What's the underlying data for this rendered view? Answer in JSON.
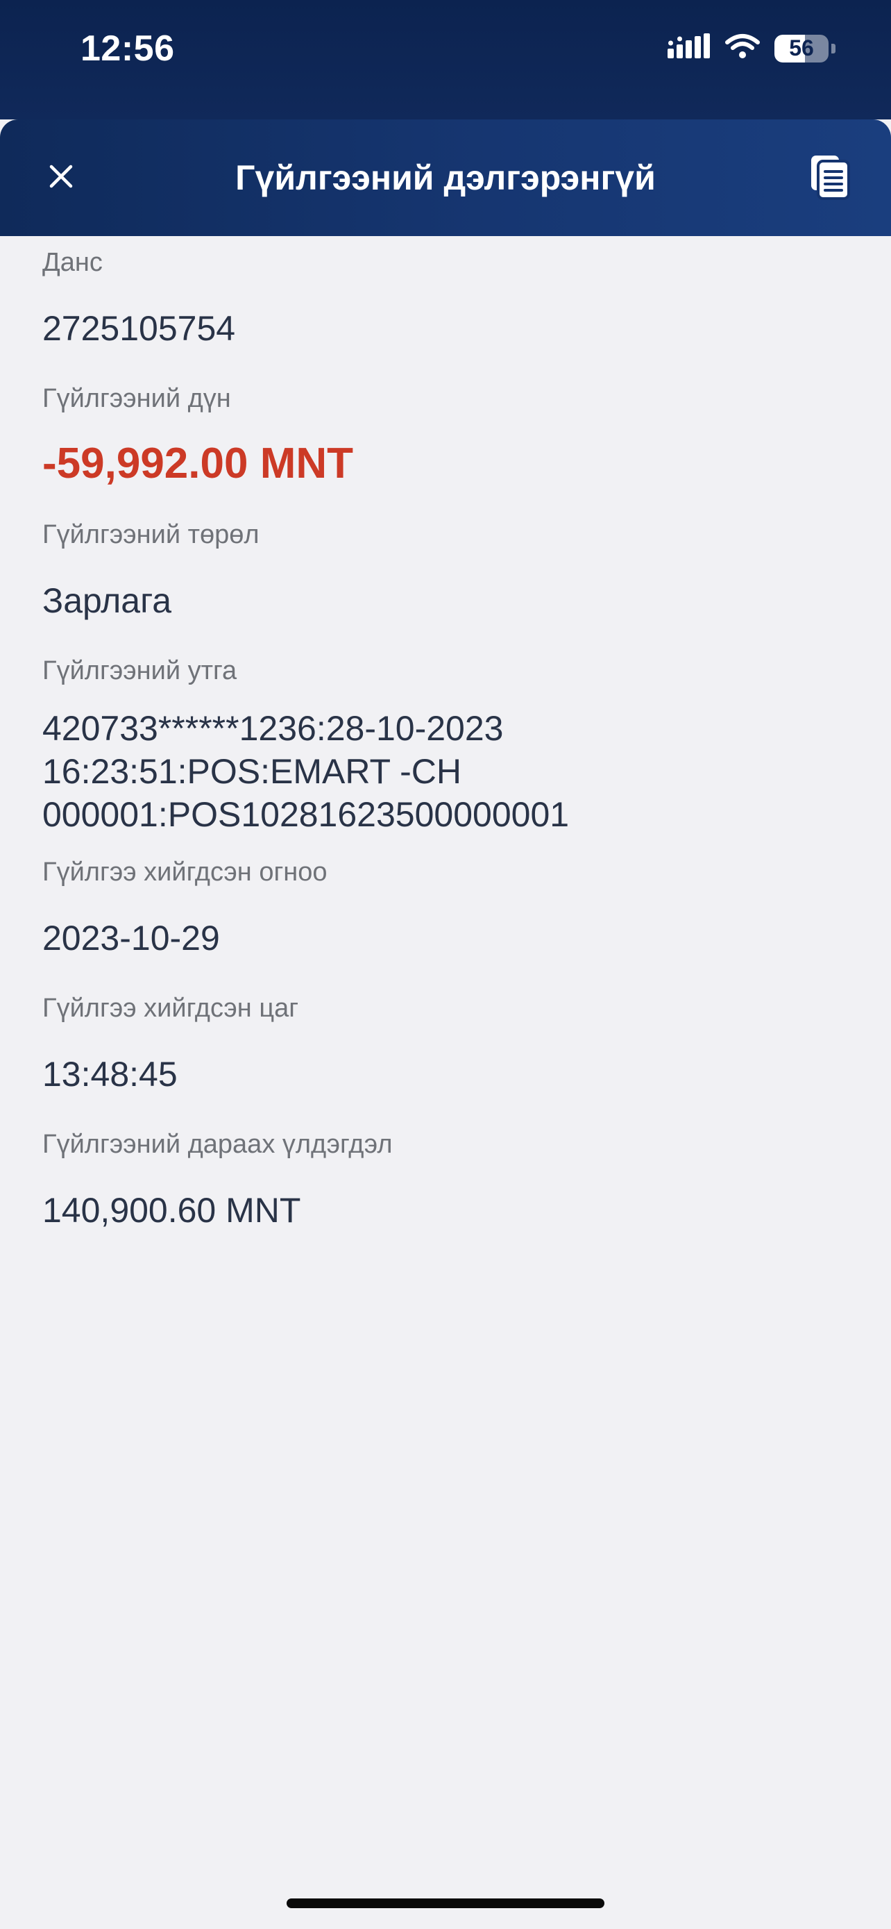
{
  "status_bar": {
    "time": "12:56",
    "battery_level": "56",
    "battery_fraction": 0.56
  },
  "header": {
    "title": "Гүйлгээний дэлгэрэнгүй",
    "close_icon": "close-icon",
    "copy_icon": "copy-document-icon"
  },
  "details": {
    "account_label": "Данс",
    "account_value": "2725105754",
    "amount_label": "Гүйлгээний дүн",
    "amount_value": "-59,992.00 MNT",
    "type_label": "Гүйлгээний төрөл",
    "type_value": "Зарлага",
    "description_label": "Гүйлгээний утга",
    "description_value": "420733******1236:28-10-2023\n16:23:51:POS:EMART -CH\n000001:POS10281623500000001",
    "date_label": "Гүйлгээ хийгдсэн огноо",
    "date_value": "2023-10-29",
    "time_label": "Гүйлгээ хийгдсэн цаг",
    "time_value": "13:48:45",
    "balance_label": "Гүйлгээний дараах үлдэгдэл",
    "balance_value": "140,900.60 MNT"
  },
  "colors": {
    "header_bg": "#163671",
    "amount_negative": "#cc3a26",
    "value_text": "#293347",
    "label_text": "#6f7278",
    "page_bg": "#f1f1f4"
  }
}
